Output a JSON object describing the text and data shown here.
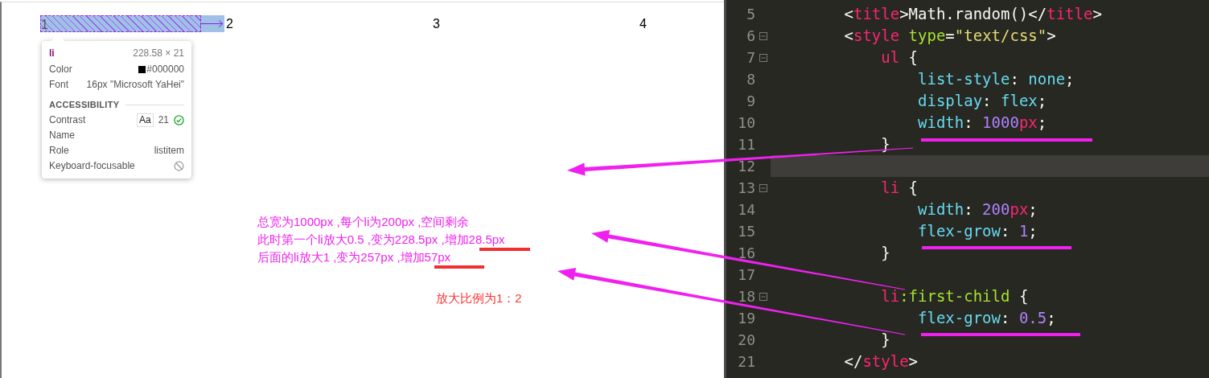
{
  "preview": {
    "items": [
      {
        "label": "1",
        "inspected": true
      },
      {
        "label": "2",
        "inspected": false
      },
      {
        "label": "3",
        "inspected": false
      },
      {
        "label": "4",
        "inspected": false
      }
    ]
  },
  "inspector_tooltip": {
    "tag": "li",
    "size": "228.58 × 21",
    "rows": [
      {
        "label": "Color",
        "value": "#000000",
        "kind": "color",
        "color": "#000000"
      },
      {
        "label": "Font",
        "value": "16px \"Microsoft YaHei\"",
        "kind": "font"
      }
    ],
    "section": "ACCESSIBILITY",
    "a11y_rows": [
      {
        "label": "Contrast",
        "kind": "contrast",
        "badge": "Aa",
        "value": "21",
        "passed": true
      },
      {
        "label": "Name",
        "kind": "text"
      },
      {
        "label": "Role",
        "kind": "text",
        "value": "listitem"
      },
      {
        "label": "Keyboard-focusable",
        "kind": "focusable",
        "focusable": false
      }
    ]
  },
  "notes": [
    {
      "kind": "explanation",
      "lines": [
        "总宽为1000px ,每个li为200px ,空间剩余",
        "此时第一个li放大0.5 ,变为228.5px ,增加28.5px",
        "后面的li放大1 ,变为257px ,增加57px"
      ]
    },
    {
      "kind": "ratio",
      "lines": [
        "放大比例为1：2"
      ]
    }
  ],
  "editor": {
    "lines": [
      {
        "number": "5",
        "fold": false,
        "highlighted": false,
        "tokens": [
          {
            "kind": "plain",
            "text": "        <"
          },
          {
            "kind": "tag",
            "text": "title"
          },
          {
            "kind": "plain",
            "text": ">Math.random()</"
          },
          {
            "kind": "tag",
            "text": "title"
          },
          {
            "kind": "plain",
            "text": ">"
          }
        ]
      },
      {
        "number": "6",
        "fold": true,
        "highlighted": false,
        "tokens": [
          {
            "kind": "plain",
            "text": "        <"
          },
          {
            "kind": "tag",
            "text": "style"
          },
          {
            "kind": "attr",
            "text": " type"
          },
          {
            "kind": "plain",
            "text": "="
          },
          {
            "kind": "string",
            "text": "\"text/css\""
          },
          {
            "kind": "plain",
            "text": ">"
          }
        ]
      },
      {
        "number": "7",
        "fold": true,
        "highlighted": false,
        "tokens": [
          {
            "kind": "tag",
            "text": "            ul"
          },
          {
            "kind": "plain",
            "text": " {"
          }
        ]
      },
      {
        "number": "8",
        "fold": false,
        "highlighted": false,
        "tokens": [
          {
            "kind": "prop",
            "text": "                list-style"
          },
          {
            "kind": "plain",
            "text": ": "
          },
          {
            "kind": "prop",
            "text": "none"
          },
          {
            "kind": "plain",
            "text": ";"
          }
        ]
      },
      {
        "number": "9",
        "fold": false,
        "highlighted": false,
        "tokens": [
          {
            "kind": "prop",
            "text": "                display"
          },
          {
            "kind": "plain",
            "text": ": "
          },
          {
            "kind": "prop",
            "text": "flex"
          },
          {
            "kind": "plain",
            "text": ";"
          }
        ]
      },
      {
        "number": "10",
        "fold": false,
        "highlighted": false,
        "tokens": [
          {
            "kind": "prop",
            "text": "                width"
          },
          {
            "kind": "plain",
            "text": ": "
          },
          {
            "kind": "number",
            "text": "1000"
          },
          {
            "kind": "unit",
            "text": "px"
          },
          {
            "kind": "plain",
            "text": ";"
          }
        ]
      },
      {
        "number": "11",
        "fold": false,
        "highlighted": false,
        "tokens": [
          {
            "kind": "plain",
            "text": "            }"
          }
        ]
      },
      {
        "number": "12",
        "fold": false,
        "highlighted": true
      },
      {
        "number": "13",
        "fold": true,
        "highlighted": false,
        "tokens": [
          {
            "kind": "tag",
            "text": "            li"
          },
          {
            "kind": "plain",
            "text": " {"
          }
        ]
      },
      {
        "number": "14",
        "fold": false,
        "highlighted": false,
        "tokens": [
          {
            "kind": "prop",
            "text": "                width"
          },
          {
            "kind": "plain",
            "text": ": "
          },
          {
            "kind": "number",
            "text": "200"
          },
          {
            "kind": "unit",
            "text": "px"
          },
          {
            "kind": "plain",
            "text": ";"
          }
        ]
      },
      {
        "number": "15",
        "fold": false,
        "highlighted": false,
        "tokens": [
          {
            "kind": "prop",
            "text": "                flex-grow"
          },
          {
            "kind": "plain",
            "text": ": "
          },
          {
            "kind": "number",
            "text": "1"
          },
          {
            "kind": "plain",
            "text": ";"
          }
        ]
      },
      {
        "number": "16",
        "fold": false,
        "highlighted": false,
        "tokens": [
          {
            "kind": "plain",
            "text": "            }"
          }
        ]
      },
      {
        "number": "17",
        "fold": false,
        "highlighted": false
      },
      {
        "number": "18",
        "fold": true,
        "highlighted": false,
        "tokens": [
          {
            "kind": "tag",
            "text": "            li"
          },
          {
            "kind": "attr",
            "text": ":first-child"
          },
          {
            "kind": "plain",
            "text": " {"
          }
        ]
      },
      {
        "number": "19",
        "fold": false,
        "highlighted": false,
        "tokens": [
          {
            "kind": "prop",
            "text": "                flex-grow"
          },
          {
            "kind": "plain",
            "text": ": "
          },
          {
            "kind": "number",
            "text": "0.5"
          },
          {
            "kind": "plain",
            "text": ";"
          }
        ]
      },
      {
        "number": "20",
        "fold": false,
        "highlighted": false,
        "tokens": [
          {
            "kind": "plain",
            "text": "            }"
          }
        ]
      },
      {
        "number": "21",
        "fold": false,
        "highlighted": false,
        "tokens": [
          {
            "kind": "plain",
            "text": "        </"
          },
          {
            "kind": "tag",
            "text": "style"
          },
          {
            "kind": "plain",
            "text": ">"
          }
        ]
      }
    ]
  }
}
